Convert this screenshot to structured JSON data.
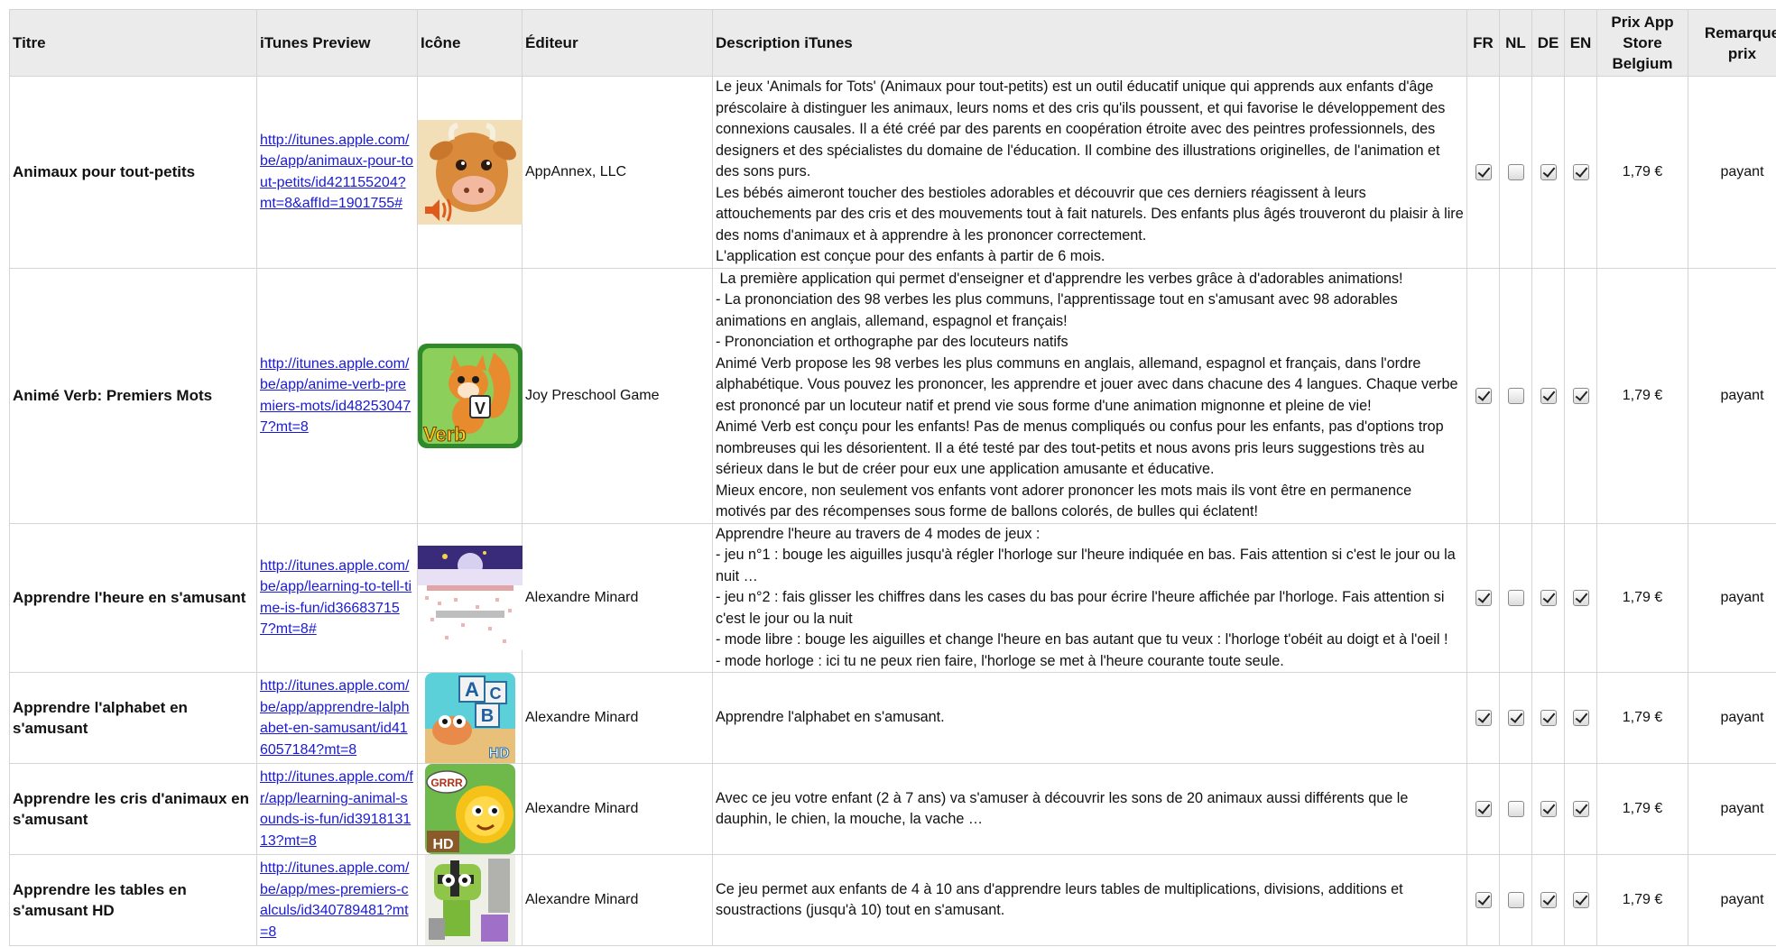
{
  "headers": {
    "title": "Titre",
    "preview": "iTunes Preview",
    "icon": "Icône",
    "publisher": "Éditeur",
    "description": "Description iTunes",
    "fr": "FR",
    "nl": "NL",
    "de": "DE",
    "en": "EN",
    "price": "Prix App Store Belgium",
    "remark": "Remarque prix"
  },
  "rows": [
    {
      "title": "Animaux pour tout-petits",
      "link": "http://itunes.apple.com/be/app/animaux-pour-tout-petits/id421155204?mt=8&affId=1901755#",
      "icon": "cow-speaker-icon",
      "publisher": "AppAnnex, LLC",
      "description": [
        "Le jeux 'Animals for Tots' (Animaux pour tout-petits) est un outil éducatif unique qui apprends aux enfants d'âge préscolaire à distinguer les animaux, leurs noms et des cris qu'ils poussent, et qui favorise le développement des connexions causales. Il a été créé par des parents en coopération étroite avec des peintres professionnels, des designers et des spécialistes du domaine de l'éducation. Il combine des illustrations originelles, de l'animation et des sons purs.",
        "Les bébés aimeront toucher des bestioles adorables et découvrir que ces derniers réagissent à leurs attouchements par des cris et des mouvements tout à fait naturels. Des enfants plus âgés trouveront du plaisir à lire des noms d'animaux et à apprendre à les prononcer correctement.",
        "L'application est conçue pour des enfants à partir de 6 mois."
      ],
      "fr": true,
      "nl": false,
      "de": true,
      "en": true,
      "price": "1,79 €",
      "remark": "payant"
    },
    {
      "title": "Animé Verb: Premiers Mots",
      "link": "http://itunes.apple.com/be/app/anime-verb-premiers-mots/id482530477?mt=8",
      "icon": "squirrel-verb-icon",
      "publisher": "Joy Preschool Game",
      "description": [
        " La première application qui permet d'enseigner et d'apprendre les verbes grâce à d'adorables animations!",
        "- La prononciation des 98 verbes les plus communs, l'apprentissage tout en s'amusant avec 98 adorables animations en anglais, allemand, espagnol et français!",
        "- Prononciation et orthographe par des locuteurs natifs",
        "Animé Verb propose les 98 verbes les plus communs en anglais, allemand, espagnol et français, dans l'ordre alphabétique. Vous pouvez les prononcer, les apprendre et jouer avec dans chacune des 4 langues. Chaque verbe est prononcé par un locuteur natif et prend vie sous forme d'une animation mignonne et pleine de vie!",
        "Animé Verb est conçu pour les enfants! Pas de menus compliqués ou confus pour les enfants, pas d'options trop nombreuses qui les désorientent. Il a été testé par des tout-petits et nous avons pris leurs suggestions très au sérieux dans le but de créer pour eux une application amusante et éducative.",
        "Mieux encore, non seulement vos enfants vont adorer prononcer les mots mais ils vont être en permanence motivés par des récompenses sous forme de ballons colorés, de bulles qui éclatent!"
      ],
      "fr": true,
      "nl": false,
      "de": true,
      "en": true,
      "price": "1,79 €",
      "remark": "payant"
    },
    {
      "title": "Apprendre l'heure en s'amusant",
      "link": "http://itunes.apple.com/be/app/learning-to-tell-time-is-fun/id366837157?mt=8#",
      "icon": "clock-game-icon",
      "publisher": "Alexandre Minard",
      "description": [
        "Apprendre l'heure au travers de 4 modes de jeux :",
        "- jeu n°1 : bouge les aiguilles jusqu'à régler l'horloge sur l'heure indiquée en bas. Fais attention si c'est le jour ou la nuit …",
        "- jeu n°2 : fais glisser les chiffres dans les cases du bas pour écrire l'heure affichée par l'horloge. Fais attention si c'est le jour ou la nuit",
        "- mode libre : bouge les aiguilles et change l'heure en bas autant que tu veux : l'horloge t'obéit au doigt et à l'oeil !",
        "- mode horloge : ici tu ne peux rien faire, l'horloge se met à l'heure courante toute seule."
      ],
      "fr": true,
      "nl": false,
      "de": true,
      "en": true,
      "price": "1,79 €",
      "remark": "payant"
    },
    {
      "title": "Apprendre l'alphabet en s'amusant",
      "link": "http://itunes.apple.com/be/app/apprendre-lalphabet-en-samusant/id416057184?mt=8",
      "icon": "abc-blocks-icon",
      "publisher": "Alexandre Minard",
      "description": [
        "Apprendre l'alphabet en s'amusant."
      ],
      "fr": true,
      "nl": true,
      "de": true,
      "en": true,
      "price": "1,79 €",
      "remark": "payant"
    },
    {
      "title": "Apprendre les cris d'animaux en s'amusant",
      "link": "http://itunes.apple.com/fr/app/learning-animal-sounds-is-fun/id391813113?mt=8",
      "icon": "lion-grrr-icon",
      "publisher": "Alexandre Minard",
      "description": [
        "Avec ce jeu votre enfant (2 à 7 ans) va s'amuser à découvrir les sons de 20 animaux aussi différents que le dauphin, le chien, la mouche, la vache …"
      ],
      "fr": true,
      "nl": false,
      "de": true,
      "en": true,
      "price": "1,79 €",
      "remark": "payant"
    },
    {
      "title": "Apprendre les tables en s'amusant HD",
      "link": "http://itunes.apple.com/be/app/mes-premiers-calculs/id340789481?mt=8",
      "icon": "math-monster-icon",
      "publisher": "Alexandre Minard",
      "description": [
        "Ce jeu permet aux enfants de 4 à 10 ans d'apprendre leurs tables de multiplications, divisions, additions et soustractions (jusqu'à 10) tout en s'amusant."
      ],
      "fr": true,
      "nl": false,
      "de": true,
      "en": true,
      "price": "1,79 €",
      "remark": "payant"
    }
  ],
  "icon_text": {
    "verb": "Verb",
    "v": "V",
    "grrr": "GRRR",
    "hd": "HD",
    "a": "A",
    "b": "B",
    "c": "C"
  }
}
